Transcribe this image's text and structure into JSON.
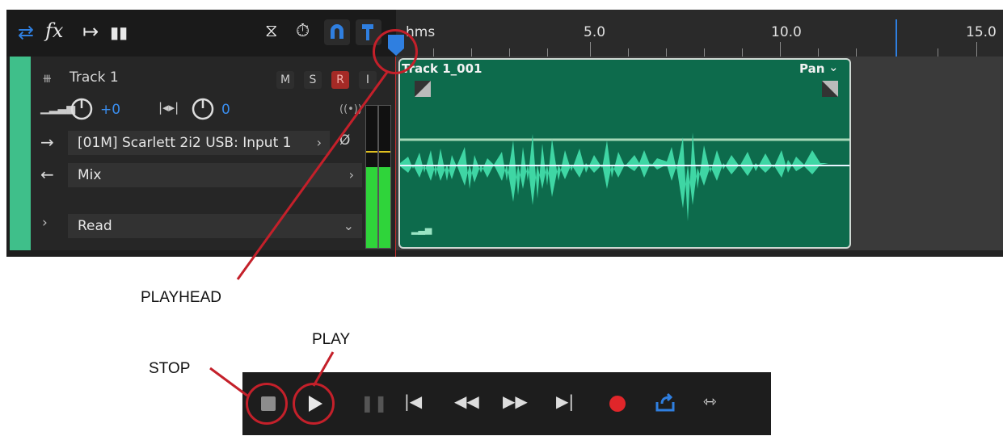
{
  "toolbar": {
    "icons": [
      "swap-icon",
      "fx-icon",
      "send-icon",
      "mixer-icon",
      "metronome-icon",
      "timer-icon",
      "snap-magnet-icon",
      "marker-icon"
    ]
  },
  "ruler": {
    "unit_label": "hms",
    "marks": [
      "5.0",
      "10.0",
      "15.0"
    ]
  },
  "track": {
    "name": "Track 1",
    "volume": "+0",
    "pan": "0",
    "buttons": {
      "mute": "M",
      "solo": "S",
      "record": "R",
      "input": "I"
    },
    "input": "[01M] Scarlett 2i2 USB: Input 1",
    "output": "Mix",
    "automation": "Read",
    "phase_symbol": "Ø"
  },
  "clip": {
    "name": "Track 1_001",
    "envelope": "Pan"
  },
  "annotations": {
    "playhead": "PLAYHEAD",
    "play": "PLAY",
    "stop": "STOP"
  },
  "colors": {
    "accent_blue": "#2f7fe0",
    "track_green": "#3fbf8a",
    "clip_green": "#0d6b4c",
    "waveform": "#3fd6a4",
    "annotation_red": "#c4202a",
    "record_red": "#e0262a"
  }
}
